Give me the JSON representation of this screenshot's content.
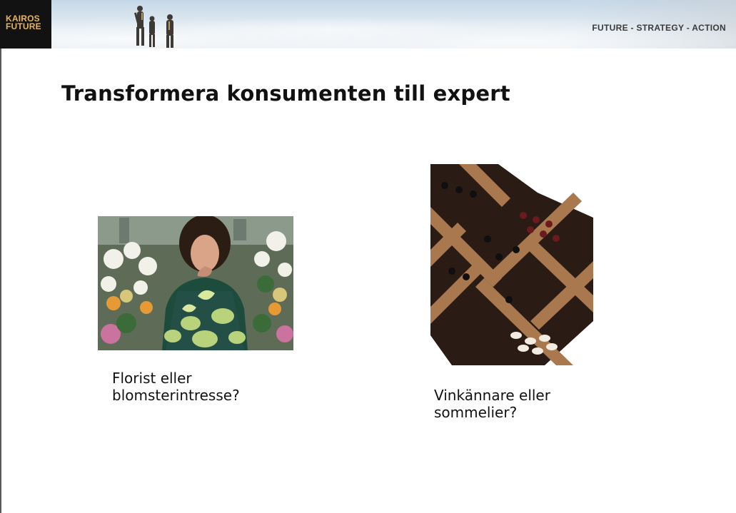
{
  "header": {
    "logo_line1": "KAIROS",
    "logo_line2": "FUTURE",
    "tagline": "FUTURE - STRATEGY - ACTION",
    "logo_color": "#e6b45a"
  },
  "slide": {
    "title": "Transformera konsumenten till expert"
  },
  "items": [
    {
      "image_icon": "florist-photo",
      "caption_line1": "Florist eller",
      "caption_line2": "blomsterintresse?"
    },
    {
      "image_icon": "wine-rack-photo",
      "caption_line1": "Vinkännare eller",
      "caption_line2": "sommelier?"
    }
  ]
}
